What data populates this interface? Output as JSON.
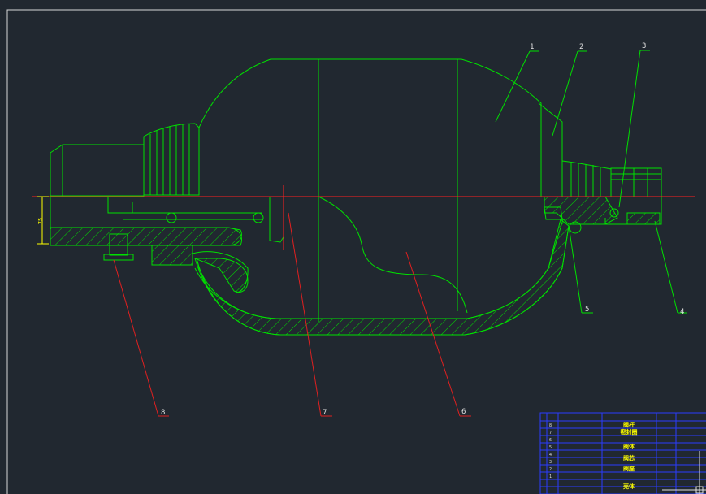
{
  "drawing": {
    "colors": {
      "background": "#212830",
      "outline": "#00e000",
      "centerline": "#ff2020",
      "leader": "#e02020",
      "dimension": "#ffff00",
      "table_lines": "#2a3cff",
      "table_text": "#ffff00"
    },
    "balloons": [
      "1",
      "2",
      "3",
      "4",
      "5",
      "6",
      "7",
      "8"
    ],
    "dimension_label": "75",
    "bom": {
      "row_numbers": [
        "8",
        "7",
        "6",
        "5",
        "4",
        "3",
        "2",
        "1"
      ],
      "names": [
        "阀杆",
        "密封圈",
        "阀体",
        "阀芯",
        "阀座",
        "",
        "",
        "壳体"
      ]
    }
  }
}
